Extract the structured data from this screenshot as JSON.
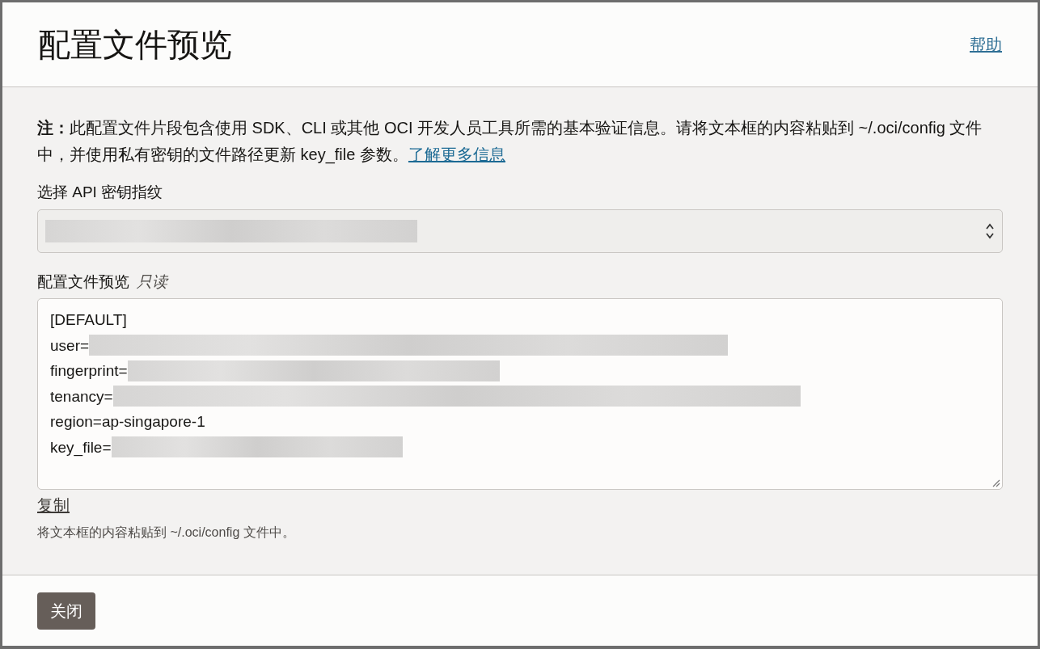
{
  "dialog": {
    "title": "配置文件预览",
    "help_link": "帮助"
  },
  "note": {
    "text": "**注：**此配置文件片段包含使用 SDK、CLI 或其他 OCI 开发人员工具所需的基本验证信息。请将文本框的内容粘贴到 ~/.oci/config 文件中，并使用私有密钥的文件路径更新 key_file 参数。",
    "link": "了解更多信息"
  },
  "fingerprint_select": {
    "label": "选择 API 密钥指纹",
    "redacted": true
  },
  "config_preview": {
    "label": "配置文件预览",
    "readonly_hint": "只读",
    "lines": [
      {
        "text": "[DEFAULT]",
        "redacted": false
      },
      {
        "text": "user=",
        "redacted": true
      },
      {
        "text": "fingerprint=",
        "redacted": true
      },
      {
        "text": "tenancy=",
        "redacted": true
      },
      {
        "text": "region=ap-singapore-1",
        "redacted": false
      },
      {
        "text": "key_file=",
        "redacted": true
      }
    ]
  },
  "copy_link": "复制",
  "helper_text": "将文本框的内容粘贴到 ~/.oci/config 文件中。",
  "buttons": [
    {
      "label": "关闭"
    }
  ]
}
